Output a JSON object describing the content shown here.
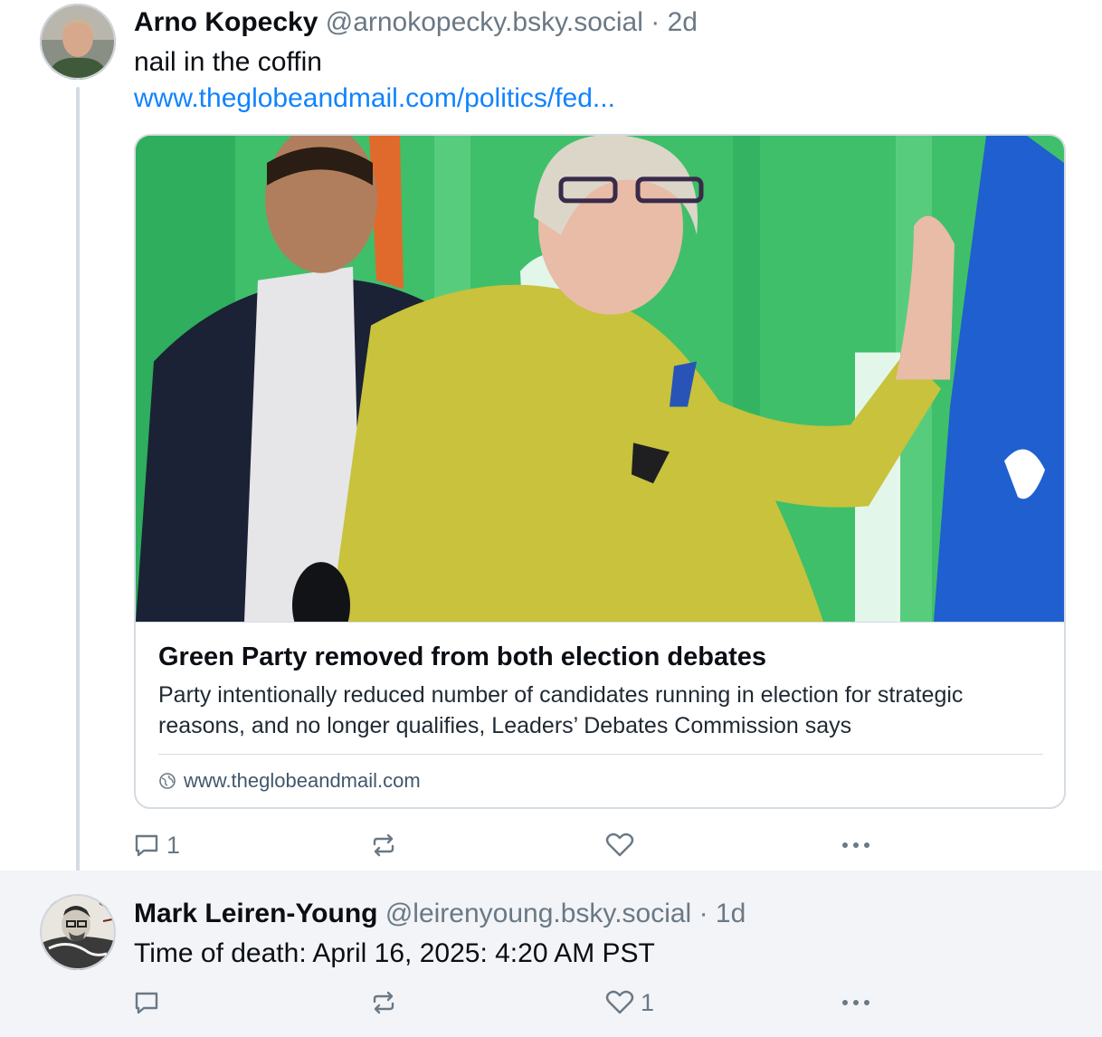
{
  "post1": {
    "author_name": "Arno Kopecky",
    "handle": "@arnokopecky.bsky.social",
    "separator": "·",
    "time": "2d",
    "text": "nail in the coffin",
    "link_text": "www.theglobeandmail.com/politics/fed...",
    "card": {
      "title": "Green Party removed from both election debates",
      "description": "Party intentionally reduced number of candidates running in election for strategic reasons, and no longer qualifies, Leaders’ Debates Commission says",
      "domain": "www.theglobeandmail.com"
    },
    "actions": {
      "reply_count": "1",
      "repost_count": "",
      "like_count": ""
    }
  },
  "post2": {
    "author_name": "Mark Leiren-Young",
    "handle": "@leirenyoung.bsky.social",
    "separator": "·",
    "time": "1d",
    "text": "Time of death: April 16, 2025: 4:20 AM PST",
    "actions": {
      "reply_count": "",
      "repost_count": "",
      "like_count": "1"
    }
  },
  "colors": {
    "link": "#1083fe",
    "muted": "#6b7885",
    "thread_line": "#d4dbe2",
    "reply_background": "#f2f4f7",
    "photo_backdrop_green": "#3fbf6a",
    "jacket_yellow": "#c8c23c",
    "flag_blue": "#1f5fd0"
  }
}
